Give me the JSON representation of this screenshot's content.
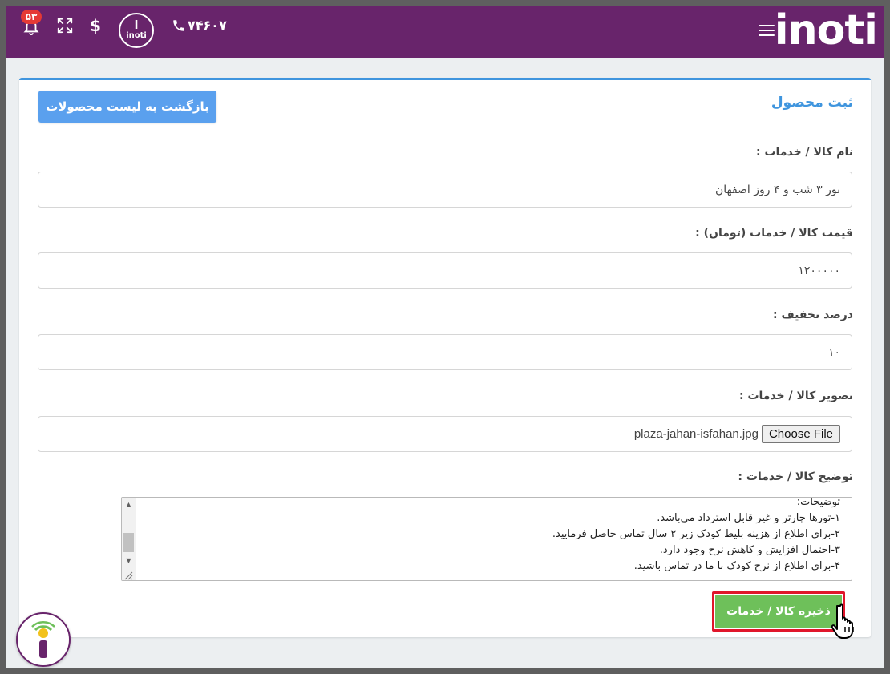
{
  "header": {
    "brand": "inoti",
    "phone": "۷۴۶۰۷",
    "notification_count": "۵۳",
    "logo_small_top": "i",
    "logo_small_text": "inoti",
    "dollar_symbol": "$"
  },
  "page": {
    "title": "ثبت محصول",
    "back_button": "بازگشت به لیست محصولات"
  },
  "form": {
    "name_label": "نام کالا / خدمات :",
    "name_value": "تور ۳ شب و ۴ روز اصفهان",
    "price_label": "قیمت کالا / خدمات (تومان) :",
    "price_value": "۱۲۰۰۰۰۰",
    "discount_label": "درصد تخفیف :",
    "discount_value": "۱۰",
    "image_label": "تصویر کالا / خدمات :",
    "file_button": "Choose File",
    "file_name": "plaza-jahan-isfahan.jpg",
    "description_label": "توضیح کالا / خدمات :",
    "description_lines": [
      "توضیحات:",
      "۱-تورها چارتر و غیر قابل استرداد می‌باشد.",
      "۲-برای اطلاع از هزینه بلیط کودک زیر ۲ سال تماس حاصل فرمایید.",
      "۳-احتمال افزایش و کاهش نرخ وجود دارد.",
      "۴-برای اطلاع از نرخ کودک با ما در تماس باشید."
    ],
    "save_button": "ذخیره کالا / خدمات"
  },
  "colors": {
    "header_bg": "#68246b",
    "accent": "#3f95de",
    "save": "#6ec05a",
    "highlight": "#e0162b",
    "badge": "#e53935"
  }
}
